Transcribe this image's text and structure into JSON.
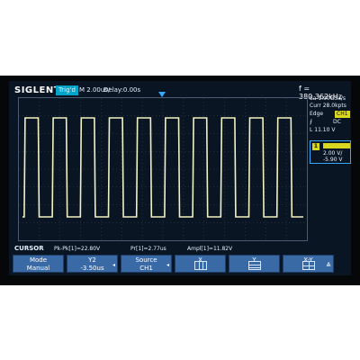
{
  "header": {
    "brand": "SIGLENT",
    "state": "Trig'd",
    "timebase": "M 2.00us/",
    "delay": "Delay:0.00s",
    "frequency": "f = 380.362kHz"
  },
  "right_panel": {
    "sample_rate": "Sa 1.00GSa/s",
    "memory": "Curr 28.0kpts",
    "trigger_type_label": "Edge",
    "trigger_source": "CH1",
    "slope_icon": "rising-edge-icon",
    "coupling": "DC",
    "trigger_level": "L 11.10 V",
    "channel": {
      "number": "1",
      "scale": "2.00 V/",
      "offset": "-5.90 V"
    }
  },
  "measurements": {
    "mode": "CURSOR",
    "items": [
      "Pk-Pk[1]=22.80V",
      "Pr[1]=2.77us",
      "Ampl[1]=11.82V"
    ]
  },
  "softkeys": [
    {
      "label": "Mode",
      "value": "Manual"
    },
    {
      "label": "Y2",
      "value": "-3.50us"
    },
    {
      "label": "Source",
      "value": "CH1"
    },
    {
      "label": "X",
      "value": "",
      "icon": "x-cursor-icon"
    },
    {
      "label": "Y",
      "value": "",
      "icon": "y-cursor-icon"
    },
    {
      "label": "X-Y",
      "value": "",
      "icon": "xy-cursor-icon"
    }
  ],
  "colors": {
    "screen_bg": "#0a1524",
    "trace": "#f2f2c0",
    "grid": "#3a4a60",
    "softkey_bg": "#3a6aa6",
    "channel_color": "#d8d820",
    "accent": "#00a4c8"
  },
  "waveform": {
    "type": "square",
    "cycles": 10
  }
}
